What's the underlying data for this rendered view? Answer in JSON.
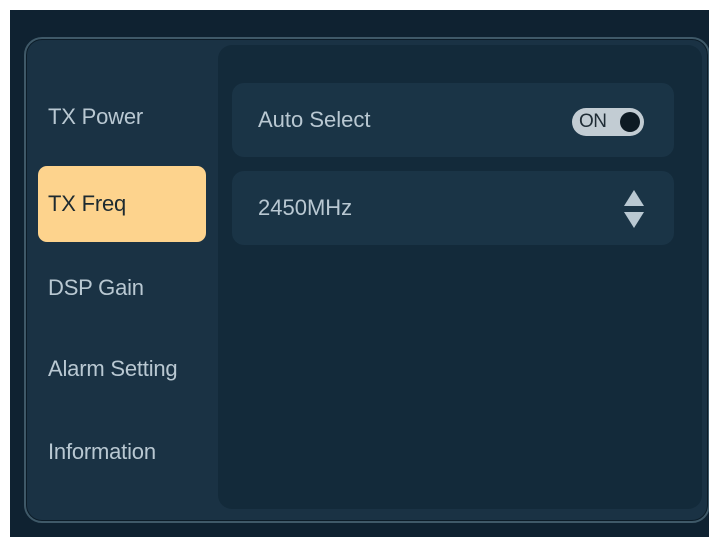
{
  "sidebar": {
    "items": [
      {
        "label": "TX Power",
        "active": false
      },
      {
        "label": "TX Freq",
        "active": true
      },
      {
        "label": "DSP Gain",
        "active": false
      },
      {
        "label": "Alarm Setting",
        "active": false
      },
      {
        "label": "Information",
        "active": false
      }
    ]
  },
  "settings": {
    "auto_select": {
      "label": "Auto Select",
      "toggle_text": "ON",
      "state": "on"
    },
    "frequency": {
      "value": "2450MHz",
      "icon": "up-down-stepper-icon"
    }
  },
  "colors": {
    "screen_bg": "#0f2231",
    "panel_bg": "#1a3244",
    "active_item": "#fdd38d",
    "text": "#b9c8d2",
    "toggle_bg": "#c2ccd3"
  }
}
